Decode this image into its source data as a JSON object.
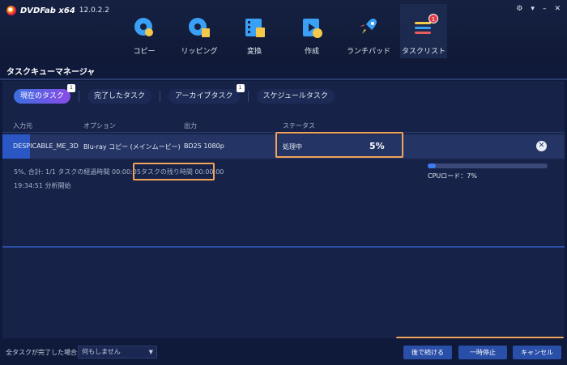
{
  "app": {
    "name": "DVDFab x64",
    "version": "12.0.2.2"
  },
  "window_controls": [
    "⚙",
    "▾",
    "–",
    "✕"
  ],
  "nav": [
    {
      "label": "コピー",
      "icon": "disc-copy-icon"
    },
    {
      "label": "リッピング",
      "icon": "disc-rip-icon"
    },
    {
      "label": "変換",
      "icon": "film-convert-icon"
    },
    {
      "label": "作成",
      "icon": "film-create-icon"
    },
    {
      "label": "ランチパッド",
      "icon": "rocket-icon"
    },
    {
      "label": "タスクリスト",
      "icon": "task-list-icon",
      "badge": "1",
      "active": true
    }
  ],
  "manager_title": "タスクキューマネージャ",
  "tabs": [
    {
      "label": "現在のタスク",
      "badge": "1",
      "active": true
    },
    {
      "label": "完了したタスク"
    },
    {
      "label": "アーカイブタスク",
      "badge": "1"
    },
    {
      "label": "スケジュールタスク"
    }
  ],
  "table": {
    "headers": {
      "source": "入力元",
      "option": "オプション",
      "output": "出力",
      "status": "ステータス"
    },
    "row": {
      "source": "DESPICABLE_ME_3D",
      "option": "Blu-ray コピー (メインムービー)",
      "output": "BD25 1080p",
      "status": "処理中",
      "percent": "5%"
    }
  },
  "info": {
    "line1_prefix": "5%, 合計: 1/1 タスクの経過時間 00:00:05",
    "remaining": "タスクの残り時間 00:00:00",
    "line2": "19:34:51 分析開始"
  },
  "cpu": {
    "label": "CPUロード：7%",
    "value": 0.07
  },
  "bottom": {
    "label": "全タスクが完了した場合:",
    "select_value": "何もしません",
    "buttons": {
      "later": "後で続ける",
      "pause": "一時停止",
      "cancel": "キャンセル"
    }
  },
  "colors": {
    "accent": "#f2a35a",
    "primary_button": "#2a4fa8",
    "progress": "#3d7bf0"
  }
}
